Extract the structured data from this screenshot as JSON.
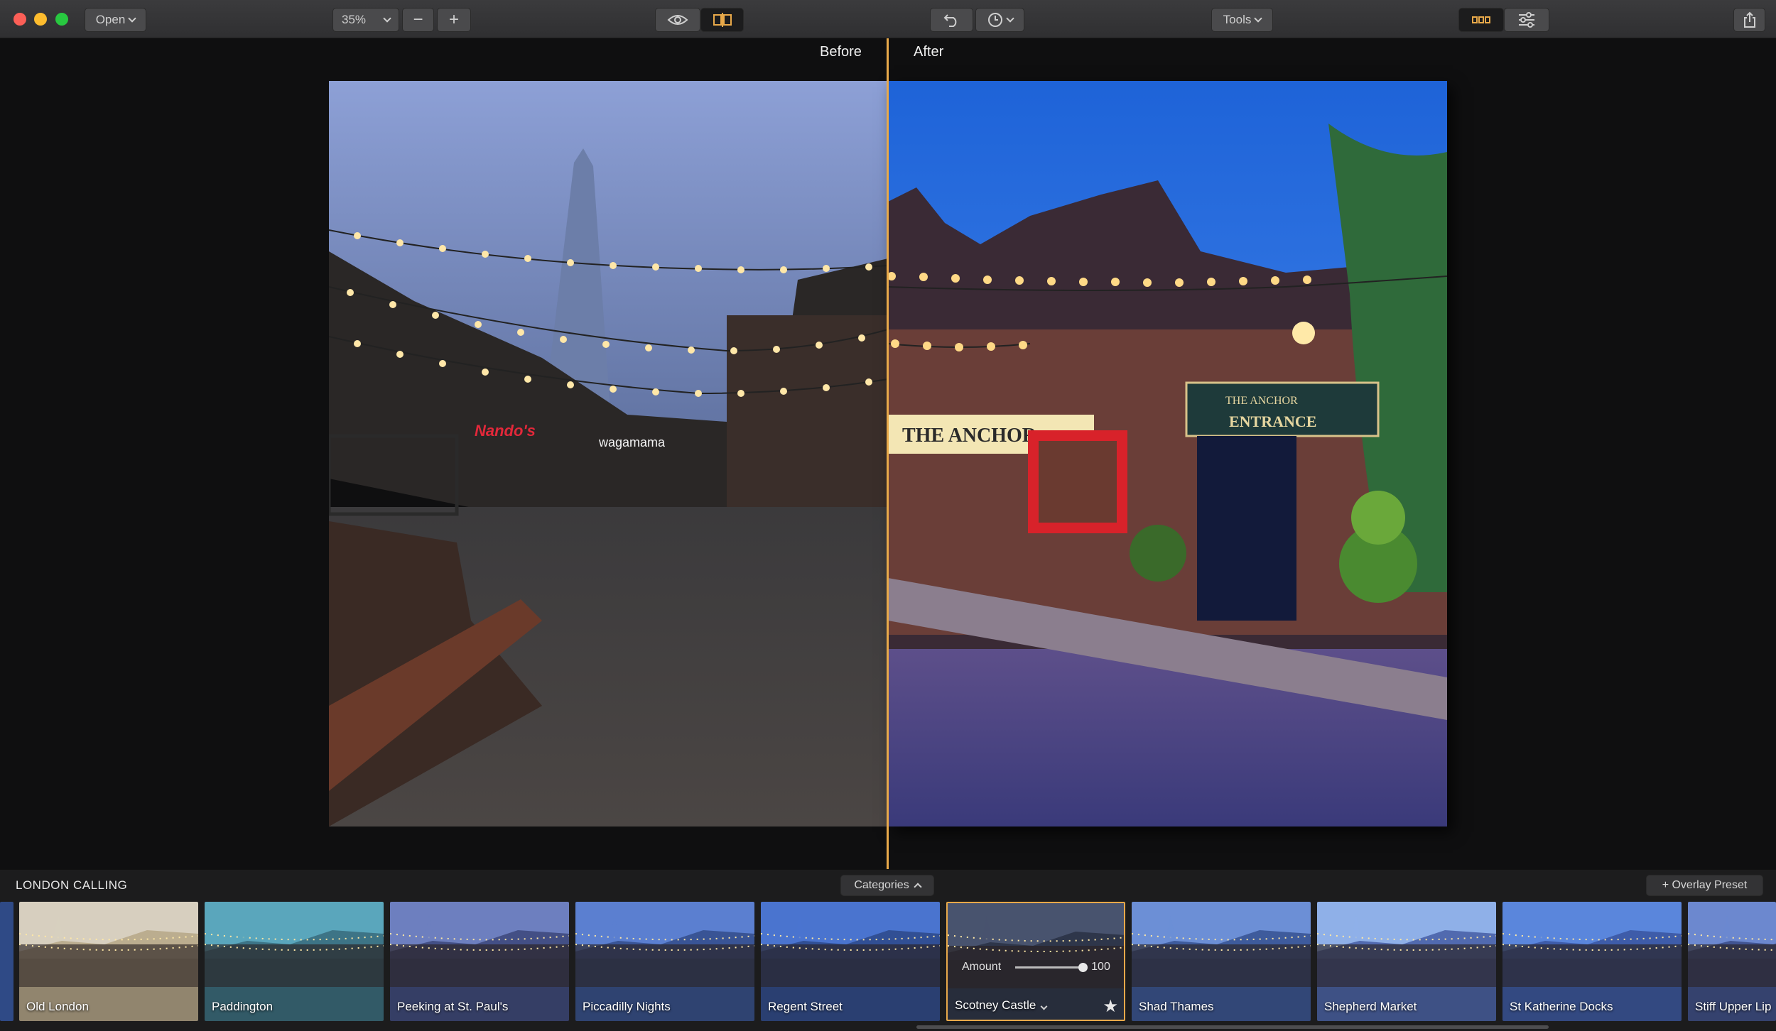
{
  "toolbar": {
    "open_label": "Open",
    "zoom_value": "35%",
    "zoom_out_symbol": "−",
    "zoom_in_symbol": "+",
    "tools_label": "Tools"
  },
  "compare": {
    "before_label": "Before",
    "after_label": "After"
  },
  "bottom_panel": {
    "category_title": "LONDON CALLING",
    "categories_label": "Categories",
    "overlay_preset_label": "+ Overlay Preset"
  },
  "presets": [
    {
      "name": "Old London",
      "tint": "#b8a88a",
      "sky": "#d7cfbf"
    },
    {
      "name": "Paddington",
      "tint": "#3a6f80",
      "sky": "#5aa6bc"
    },
    {
      "name": "Peeking at St. Paul's",
      "tint": "#3e4a7e",
      "sky": "#6d7fbf"
    },
    {
      "name": "Piccadilly Nights",
      "tint": "#35508e",
      "sky": "#5b7fd0"
    },
    {
      "name": "Regent Street",
      "tint": "#2f4b8d",
      "sky": "#4a74cf"
    },
    {
      "name": "Scotney Castle",
      "tint": "#2b3346",
      "sky": "#48536e"
    },
    {
      "name": "Shad Thames",
      "tint": "#3a5596",
      "sky": "#6c8fd6"
    },
    {
      "name": "Shepherd Market",
      "tint": "#4a63a8",
      "sky": "#8fb0e8"
    },
    {
      "name": "St Katherine Docks",
      "tint": "#3b58a3",
      "sky": "#5a86dc"
    },
    {
      "name": "Stiff Upper Lip",
      "tint": "#3d4f8a",
      "sky": "#6c88cf"
    }
  ],
  "selected_preset": {
    "amount_label": "Amount",
    "amount_value": "100",
    "amount_fraction": 1.0
  },
  "accent_color": "#e8a94a"
}
